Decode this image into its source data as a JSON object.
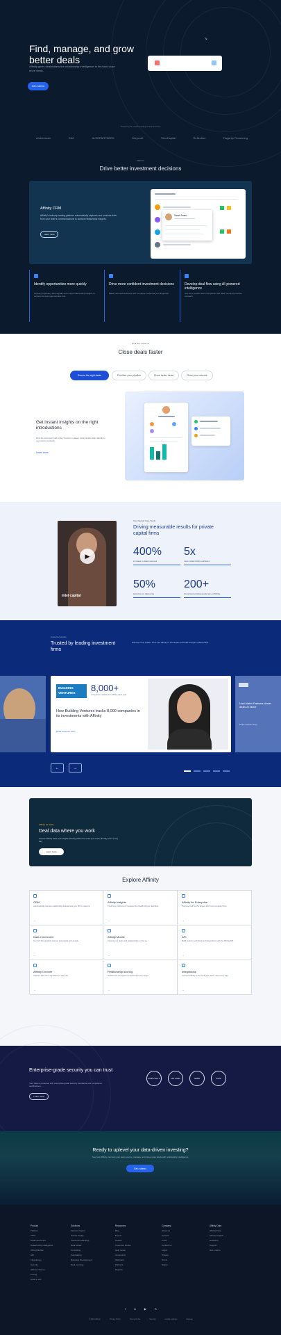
{
  "hero": {
    "title": "Find, manage, and grow better deals",
    "subtitle": "Affinity gives dealmakers the relationship intelligence to find and close more deals.",
    "cta": "Get a demo",
    "logos_label": "Trusted by the world's leading investment firms",
    "logos": [
      "Andreessen",
      "RAC",
      "ALSOPARTNERS",
      "Greycroft",
      "TribeCapital",
      "Reflection",
      "Flagship Pioneering"
    ]
  },
  "drive": {
    "eyebrow": "Platform",
    "title": "Drive better investment decisions",
    "crm_title": "Affinity CRM",
    "crm_desc": "Affinity's industry leading platform automatically captures and enriches data from your team's communications to surface relationship insights.",
    "crm_cta": "Learn more",
    "mock_contact": "Sarah Jonas",
    "features": [
      {
        "title": "Identify opportunities more quickly",
        "desc": "Access proprietary data signals and unique relationship insights to surface the best opportunities first."
      },
      {
        "title": "Drive more confident investment decisions",
        "desc": "Make informed decisions with complete context at your fingertips."
      },
      {
        "title": "Develop deal flow using AI-powered intelligence",
        "desc": "Use AI to predict which companies will raise next and prioritize outreach."
      }
    ]
  },
  "fast": {
    "eyebrow": "Deal flow solutions",
    "title": "Close deals faster",
    "tabs": [
      "Source the right deals",
      "Prioritize your pipeline",
      "Close better deals",
      "Grow your network"
    ],
    "heading": "Get instant insights on the right introductions",
    "desc": "Find the strongest path to key decision makers using relationship data from your team's network.",
    "link": "Learn more"
  },
  "results": {
    "eyebrow": "Intel Capital Case Study",
    "title": "Driving measurable results for private capital firms",
    "video_caption": "intel capital",
    "stats": [
      {
        "value": "400%",
        "label": "increase in deals sourced"
      },
      {
        "value": "5x",
        "label": "more relationships surfaced"
      },
      {
        "value": "50%",
        "label": "less time on data entry"
      },
      {
        "value": "200+",
        "label": "investment professionals rely on Affinity"
      }
    ]
  },
  "trusted": {
    "eyebrow": "Customer stories",
    "title": "Trusted by leading investment firms",
    "desc": "Discover how 3,000+ firms use Affinity to find deals and build stronger relationships.",
    "card_logo_top": "BUILDING",
    "card_logo_bottom": "VENTURES",
    "card_stat": "8,000+",
    "card_stat_label": "companies evaluated in Affinity each year",
    "card_title": "How Building Ventures tracks 8,000 companies in its investments with Affinity",
    "card_link": "Read customer story",
    "side_card_title": "How Matrix Partners closes deals 2x faster",
    "side_link": "Read customer story",
    "prev": "←",
    "next": "→"
  },
  "explore": {
    "banner_eyebrow": "Affinity for deals",
    "banner_title": "Deal data where you work",
    "banner_desc": "Access Affinity data and insights directly within the tools your team already uses every day.",
    "banner_cta": "Learn more",
    "title": "Explore Affinity",
    "cells": [
      {
        "title": "CRM",
        "desc": "Automatically capture relationship data across your firm's network."
      },
      {
        "title": "Affinity Insights",
        "desc": "Track key metrics and measure the health of your deal flow."
      },
      {
        "title": "Affinity for Enterprise",
        "desc": "Purpose built for the largest and most complex firms."
      },
      {
        "title": "Data enrichment",
        "desc": "Get rich firmographic data on companies and people."
      },
      {
        "title": "Affinity Mobile",
        "desc": "Access your deals and relationships on the go."
      },
      {
        "title": "API",
        "desc": "Build custom workflows and integrations with the Affinity API."
      },
      {
        "title": "Affinity Chrome",
        "desc": "Capture data from anywhere on the web."
      },
      {
        "title": "Relationship scoring",
        "desc": "Surface the strongest connections to any target."
      },
      {
        "title": "Integrations",
        "desc": "Connect Affinity to the tools your team uses every day."
      }
    ]
  },
  "security": {
    "title": "Enterprise-grade security you can trust",
    "desc": "Your data is protected with enterprise-grade security standards and compliance certifications.",
    "cta": "Learn more",
    "badges": [
      "AICPA SOC 2",
      "ISO 27001",
      "GDPR",
      "CCPA"
    ]
  },
  "cta": {
    "title": "Ready to uplevel your data-driven investing?",
    "desc": "See how Affinity can help your team source, manage, and close more deals with relationship intelligence.",
    "button": "Get a demo"
  },
  "footer": {
    "columns": [
      {
        "head": "Product",
        "items": [
          "Platform",
          "CRM",
          "Data enrichment",
          "Relationship intelligence",
          "Affinity Mobile",
          "API",
          "Integrations",
          "Security",
          "Affinity Chrome",
          "Pricing",
          "What's new"
        ]
      },
      {
        "head": "Solutions",
        "items": [
          "Venture Capital",
          "Private Equity",
          "Investment Banking",
          "Real Estate",
          "Consulting",
          "Fundraising",
          "Business Development",
          "Deal sourcing"
        ]
      },
      {
        "head": "Resources",
        "items": [
          "Blog",
          "Events",
          "Guides",
          "Customer stories",
          "Help center",
          "Community",
          "Webinars",
          "Partners",
          "Reports"
        ]
      },
      {
        "head": "Company",
        "items": [
          "About us",
          "Careers",
          "Press",
          "Contact us",
          "Legal",
          "Privacy",
          "Terms",
          "Status"
        ]
      },
      {
        "head": "Affinity Data",
        "items": [
          "Affinity Data",
          "Affinity Insights",
          "Research",
          "Support",
          "Get a demo"
        ]
      }
    ],
    "social": [
      "f",
      "in",
      "▶",
      "𝕏"
    ],
    "legal": [
      "© 2024 Affinity",
      "Privacy Policy",
      "Terms of Use",
      "Security",
      "Cookie settings",
      "Sitemap"
    ]
  }
}
